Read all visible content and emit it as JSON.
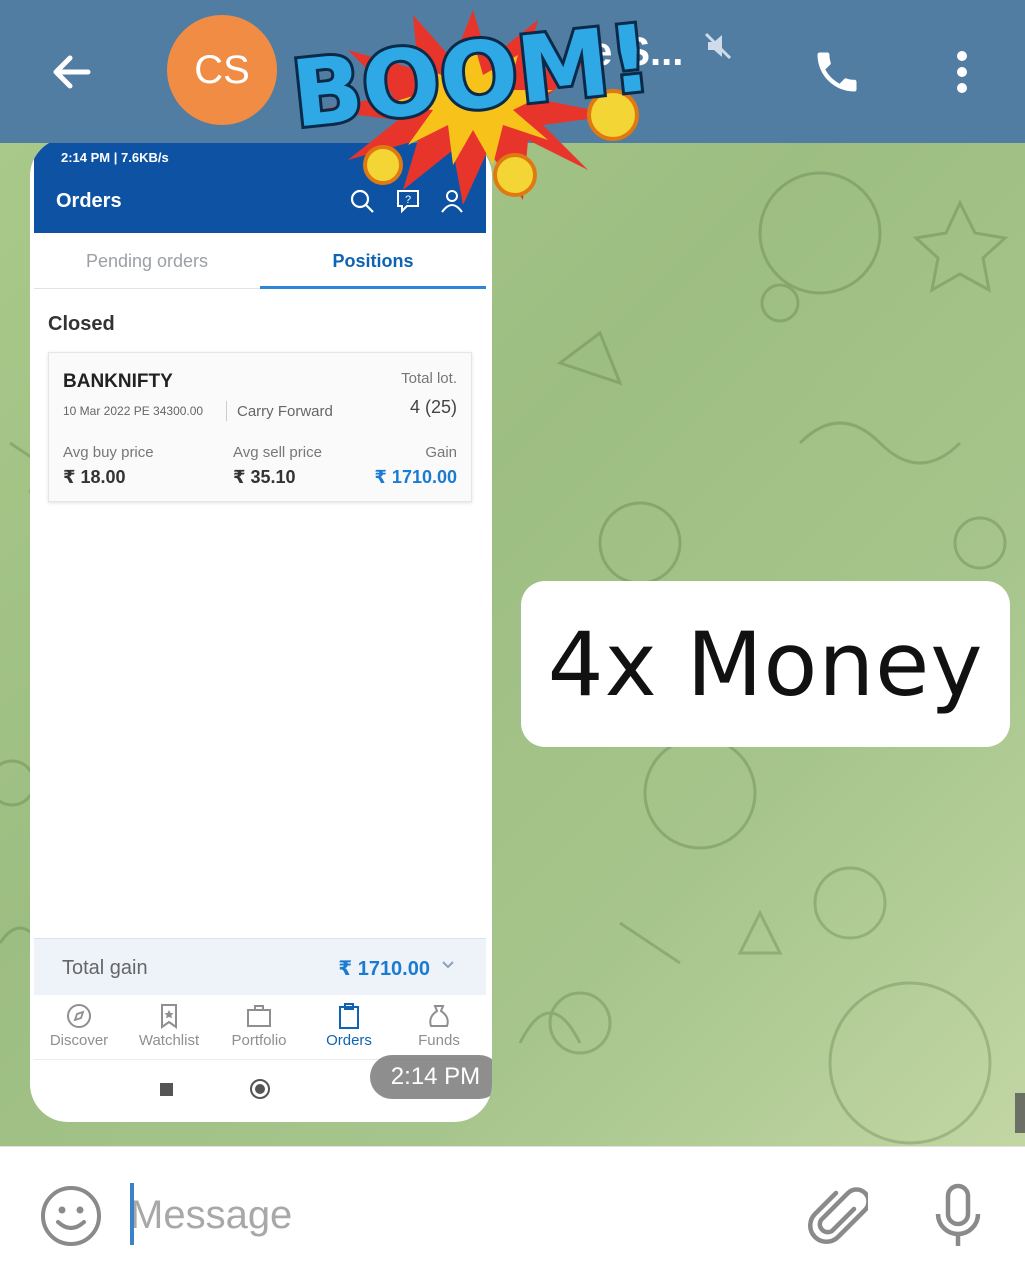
{
  "header": {
    "avatar_initials": "CS",
    "chat_title": "e S...",
    "icons": {
      "back": "arrow-left-icon",
      "mute": "muted-speaker-icon",
      "call": "phone-icon",
      "menu": "more-vertical-icon"
    }
  },
  "sticker_boom": {
    "text": "BOOM!"
  },
  "screenshot": {
    "status_bar": "2:14 PM | 7.6KB/s",
    "title": "Orders",
    "tabs": [
      "Pending orders",
      "Positions"
    ],
    "active_tab": "Positions",
    "section": "Closed",
    "position": {
      "symbol": "BANKNIFTY",
      "contract": "10 Mar 2022 PE 34300.00",
      "product": "Carry Forward",
      "total_lot_label": "Total lot.",
      "total_lot_value": "4 (25)",
      "avg_buy_label": "Avg buy price",
      "avg_buy_value": "₹ 18.00",
      "avg_sell_label": "Avg sell price",
      "avg_sell_value": "₹ 35.10",
      "gain_label": "Gain",
      "gain_value": "₹ 1710.00"
    },
    "total_gain_label": "Total gain",
    "total_gain_value": "₹ 1710.00",
    "nav": [
      {
        "label": "Discover",
        "icon": "compass-icon"
      },
      {
        "label": "Watchlist",
        "icon": "bookmark-icon"
      },
      {
        "label": "Portfolio",
        "icon": "briefcase-icon"
      },
      {
        "label": "Orders",
        "icon": "clipboard-icon"
      },
      {
        "label": "Funds",
        "icon": "money-bag-icon"
      }
    ],
    "active_nav": "Orders"
  },
  "message_time": "2:14 PM",
  "sticker_text": "4x Money",
  "input": {
    "placeholder": "Message"
  },
  "colors": {
    "header": "#527da3",
    "avatar": "#f08c43",
    "accent": "#1b7bd0",
    "chat_bg": "#a9c98a"
  }
}
